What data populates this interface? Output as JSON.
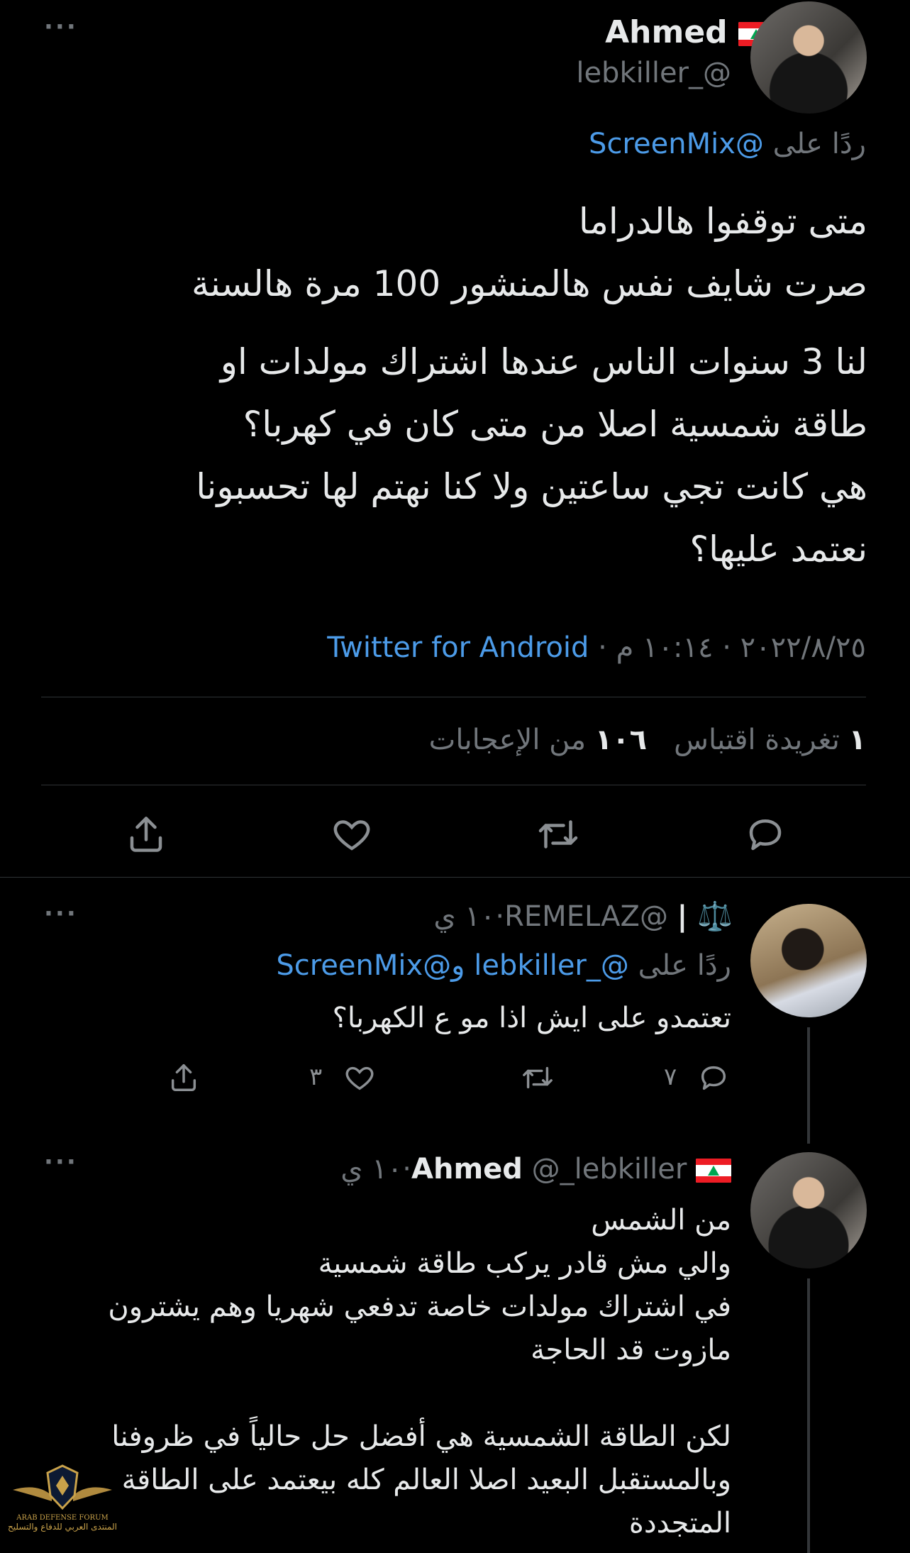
{
  "main_tweet": {
    "display_name": "Ahmed",
    "handle": "@_lebkiller",
    "reply_to_label": "ردًا على",
    "reply_to_handle": "@ScreenMix",
    "body_lines_1": [
      "متى توقفوا هالدراما",
      "صرت شايف نفس هالمنشور 100 مرة هالسنة"
    ],
    "body_lines_2": [
      "لنا 3 سنوات الناس عندها اشتراك مولدات او",
      "طاقة شمسية اصلا من متى كان في كهربا؟",
      "هي كانت تجي ساعتين ولا كنا نهتم لها تحسبونا",
      "نعتمد عليها؟"
    ],
    "timestamp": "٢٠٢٢/٨/٢٥ · ١٠:١٤ م ·",
    "source": "Twitter for Android",
    "quote_count": "١",
    "quote_label": "تغريدة اقتباس",
    "like_count": "١٠٦",
    "like_label": "من الإعجابات"
  },
  "reply_1": {
    "name_prefix": "⚖️ |",
    "handle": "@REMELAZ",
    "time": "١٠ ي",
    "reply_to_label": "ردًا على",
    "reply_to_handles": "@_lebkiller و@ScreenMix",
    "body": "تعتمدو على ايش اذا مو ع الكهربا؟",
    "reply_count": "٧",
    "like_count": "٣"
  },
  "reply_2": {
    "display_name": "Ahmed",
    "handle": "@_lebkiller",
    "time": "١٠ ي",
    "body_lines": [
      "من الشمس",
      "والي مش قادر يركب طاقة شمسية",
      "في اشتراك مولدات خاصة تدفعي شهريا وهم يشترون",
      "مازوت قد الحاجة",
      "",
      "لكن الطاقة الشمسية هي أفضل حل حالياً في ظروفنا",
      "وبالمستقبل البعيد اصلا العالم كله بيعتمد على الطاقة",
      "المتجددة"
    ]
  },
  "watermark": {
    "line1": "ARAB DEFENSE FORUM",
    "line2": "المنتدى العربي للدفاع والتسليح"
  },
  "icons": {
    "more": "more-icon",
    "reply": "reply-icon",
    "retweet": "retweet-icon",
    "like": "like-icon",
    "share": "share-icon"
  },
  "colors": {
    "background": "#000000",
    "text": "#e7e9ea",
    "muted": "#71767b",
    "link": "#4c9be8"
  }
}
